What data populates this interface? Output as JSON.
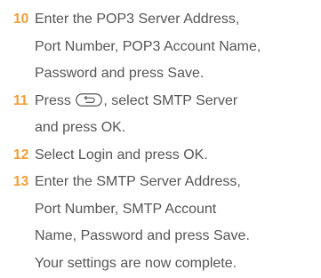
{
  "accent_color": "#f39c34",
  "text_color": "#555555",
  "steps": [
    {
      "number": "10",
      "lines": [
        "Enter the POP3 Server Address,",
        "Port Number, POP3 Account Name,",
        "Password and press Save."
      ]
    },
    {
      "number": "11",
      "line1_pre": "Press",
      "key_icon": "back-key-icon",
      "line1_post": ", select SMTP Server",
      "lines": [
        "and press OK."
      ]
    },
    {
      "number": "12",
      "lines": [
        "Select Login and press OK."
      ]
    },
    {
      "number": "13",
      "lines": [
        "Enter the SMTP Server Address,",
        "Port Number, SMTP Account",
        "Name, Password and press Save.",
        "Your settings are now complete."
      ]
    }
  ]
}
